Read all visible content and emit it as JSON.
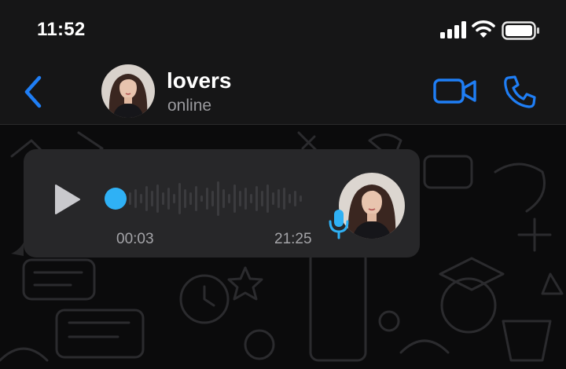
{
  "status_bar": {
    "time": "11:52",
    "icons": [
      "signal-bars-icon",
      "wifi-icon",
      "battery-icon"
    ]
  },
  "header": {
    "contact_name": "lovers",
    "contact_status": "online",
    "icons": [
      "chevron-left-icon",
      "video-camera-icon",
      "phone-icon"
    ]
  },
  "voice_message": {
    "duration": "00:03",
    "timestamp": "21:25",
    "playback_progress": 0,
    "icons": [
      "play-icon",
      "microphone-icon"
    ]
  },
  "colors": {
    "accent": "#1f7ef5",
    "scrubber": "#2fb1f5",
    "bubble": "#272729",
    "bar_background": "#161617",
    "chat_background": "#0b0b0c"
  }
}
